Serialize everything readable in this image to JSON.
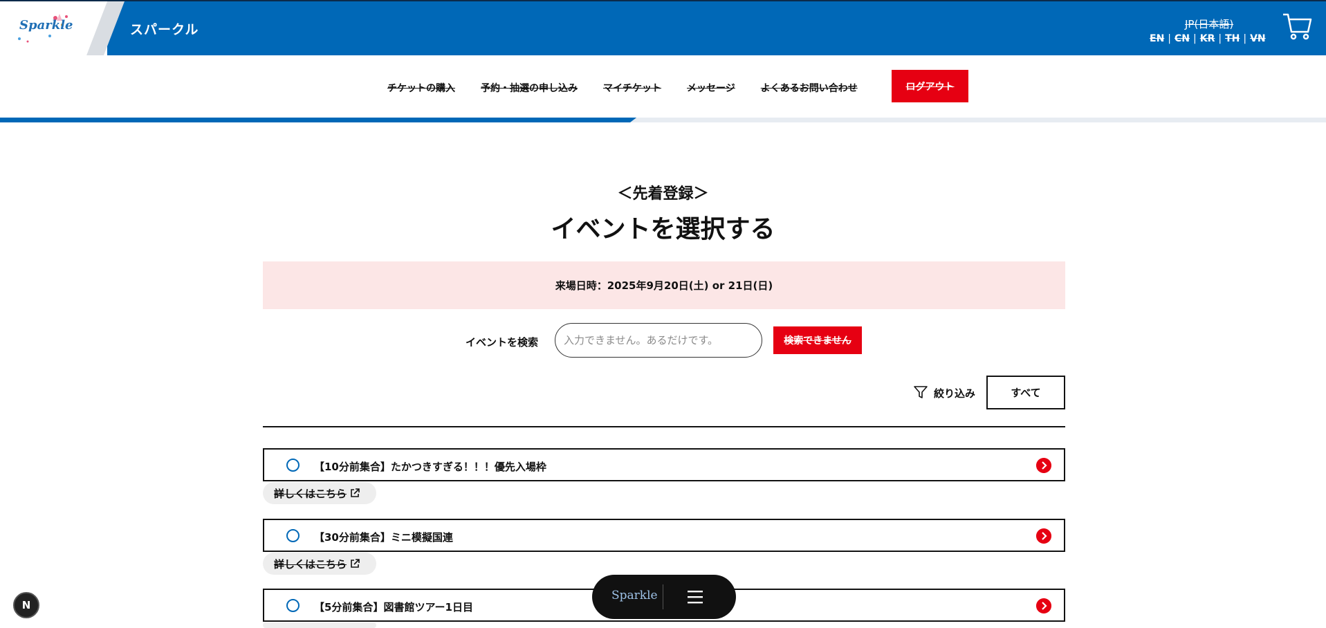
{
  "header": {
    "logo_text": "Sparkle",
    "site_title": "スパークル",
    "lang_current": "JP(日本語)",
    "languages": [
      "EN",
      "CN",
      "KR",
      "TH",
      "VN"
    ],
    "colors": {
      "primary": "#0068b7",
      "accent": "#e60012"
    }
  },
  "nav": {
    "items": [
      "チケットの購入",
      "予約・抽選の申し込み",
      "マイチケット",
      "メッセージ",
      "よくあるお問い合わせ"
    ],
    "logout_label": "ログアウト",
    "progress": 0.48
  },
  "main": {
    "subheading": "＜先着登録＞",
    "title": "イベントを選択する",
    "date_banner": "来場日時：2025年9月20日(土) or 21日(日)",
    "search": {
      "label": "イベントを検索",
      "placeholder": "入力できません。あるだけです。",
      "button_label": "検索できません"
    },
    "filter": {
      "label": "絞り込み",
      "selected": "すべて"
    },
    "events": [
      {
        "name": "【10分前集合】たかつきすぎる！！！優先入場枠",
        "detail_label": "詳しくはこちら"
      },
      {
        "name": "【30分前集合】ミニ模擬国連",
        "detail_label": "詳しくはこちら"
      },
      {
        "name": "【5分前集合】図書館ツアー1日目",
        "detail_label": ""
      }
    ]
  },
  "floating_bar": {
    "brand": "Sparkle",
    "menu_icon": "hamburger-menu-icon"
  },
  "dev_badge": "N"
}
